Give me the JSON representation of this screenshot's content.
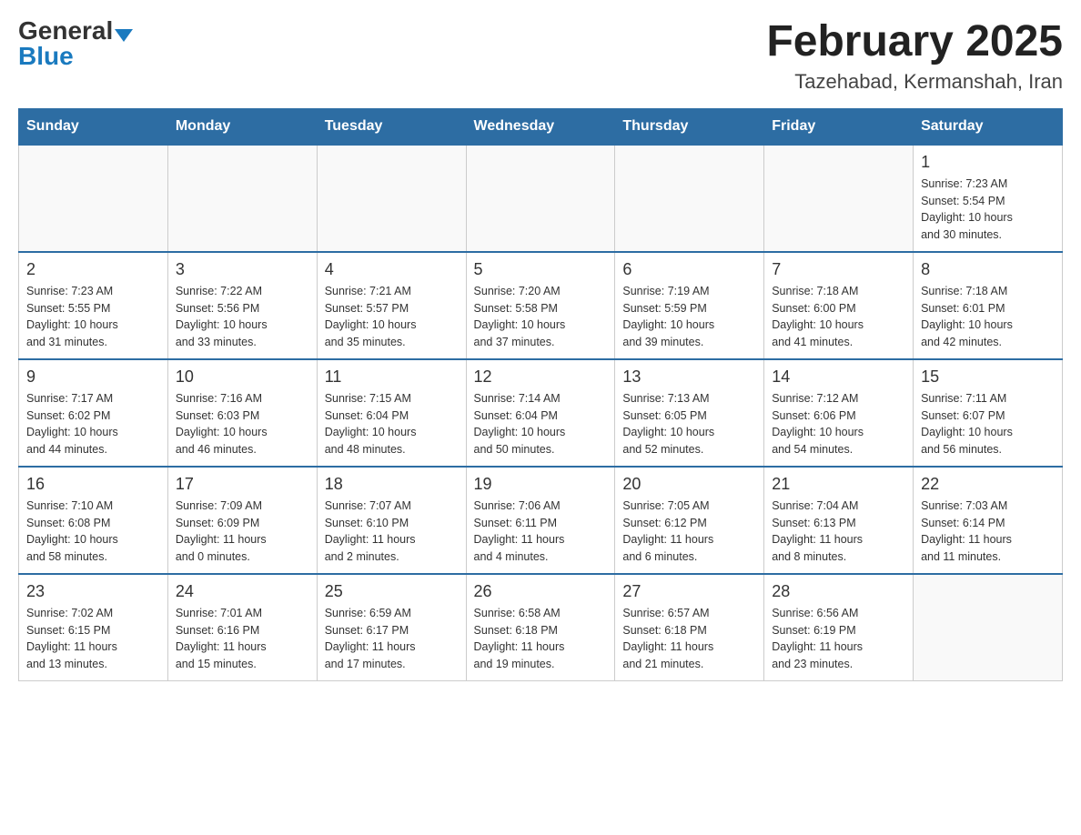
{
  "header": {
    "logo_general": "General",
    "logo_blue": "Blue",
    "month_year": "February 2025",
    "location": "Tazehabad, Kermanshah, Iran"
  },
  "days_of_week": [
    "Sunday",
    "Monday",
    "Tuesday",
    "Wednesday",
    "Thursday",
    "Friday",
    "Saturday"
  ],
  "weeks": [
    {
      "days": [
        {
          "date": "",
          "info": ""
        },
        {
          "date": "",
          "info": ""
        },
        {
          "date": "",
          "info": ""
        },
        {
          "date": "",
          "info": ""
        },
        {
          "date": "",
          "info": ""
        },
        {
          "date": "",
          "info": ""
        },
        {
          "date": "1",
          "info": "Sunrise: 7:23 AM\nSunset: 5:54 PM\nDaylight: 10 hours\nand 30 minutes."
        }
      ]
    },
    {
      "days": [
        {
          "date": "2",
          "info": "Sunrise: 7:23 AM\nSunset: 5:55 PM\nDaylight: 10 hours\nand 31 minutes."
        },
        {
          "date": "3",
          "info": "Sunrise: 7:22 AM\nSunset: 5:56 PM\nDaylight: 10 hours\nand 33 minutes."
        },
        {
          "date": "4",
          "info": "Sunrise: 7:21 AM\nSunset: 5:57 PM\nDaylight: 10 hours\nand 35 minutes."
        },
        {
          "date": "5",
          "info": "Sunrise: 7:20 AM\nSunset: 5:58 PM\nDaylight: 10 hours\nand 37 minutes."
        },
        {
          "date": "6",
          "info": "Sunrise: 7:19 AM\nSunset: 5:59 PM\nDaylight: 10 hours\nand 39 minutes."
        },
        {
          "date": "7",
          "info": "Sunrise: 7:18 AM\nSunset: 6:00 PM\nDaylight: 10 hours\nand 41 minutes."
        },
        {
          "date": "8",
          "info": "Sunrise: 7:18 AM\nSunset: 6:01 PM\nDaylight: 10 hours\nand 42 minutes."
        }
      ]
    },
    {
      "days": [
        {
          "date": "9",
          "info": "Sunrise: 7:17 AM\nSunset: 6:02 PM\nDaylight: 10 hours\nand 44 minutes."
        },
        {
          "date": "10",
          "info": "Sunrise: 7:16 AM\nSunset: 6:03 PM\nDaylight: 10 hours\nand 46 minutes."
        },
        {
          "date": "11",
          "info": "Sunrise: 7:15 AM\nSunset: 6:04 PM\nDaylight: 10 hours\nand 48 minutes."
        },
        {
          "date": "12",
          "info": "Sunrise: 7:14 AM\nSunset: 6:04 PM\nDaylight: 10 hours\nand 50 minutes."
        },
        {
          "date": "13",
          "info": "Sunrise: 7:13 AM\nSunset: 6:05 PM\nDaylight: 10 hours\nand 52 minutes."
        },
        {
          "date": "14",
          "info": "Sunrise: 7:12 AM\nSunset: 6:06 PM\nDaylight: 10 hours\nand 54 minutes."
        },
        {
          "date": "15",
          "info": "Sunrise: 7:11 AM\nSunset: 6:07 PM\nDaylight: 10 hours\nand 56 minutes."
        }
      ]
    },
    {
      "days": [
        {
          "date": "16",
          "info": "Sunrise: 7:10 AM\nSunset: 6:08 PM\nDaylight: 10 hours\nand 58 minutes."
        },
        {
          "date": "17",
          "info": "Sunrise: 7:09 AM\nSunset: 6:09 PM\nDaylight: 11 hours\nand 0 minutes."
        },
        {
          "date": "18",
          "info": "Sunrise: 7:07 AM\nSunset: 6:10 PM\nDaylight: 11 hours\nand 2 minutes."
        },
        {
          "date": "19",
          "info": "Sunrise: 7:06 AM\nSunset: 6:11 PM\nDaylight: 11 hours\nand 4 minutes."
        },
        {
          "date": "20",
          "info": "Sunrise: 7:05 AM\nSunset: 6:12 PM\nDaylight: 11 hours\nand 6 minutes."
        },
        {
          "date": "21",
          "info": "Sunrise: 7:04 AM\nSunset: 6:13 PM\nDaylight: 11 hours\nand 8 minutes."
        },
        {
          "date": "22",
          "info": "Sunrise: 7:03 AM\nSunset: 6:14 PM\nDaylight: 11 hours\nand 11 minutes."
        }
      ]
    },
    {
      "days": [
        {
          "date": "23",
          "info": "Sunrise: 7:02 AM\nSunset: 6:15 PM\nDaylight: 11 hours\nand 13 minutes."
        },
        {
          "date": "24",
          "info": "Sunrise: 7:01 AM\nSunset: 6:16 PM\nDaylight: 11 hours\nand 15 minutes."
        },
        {
          "date": "25",
          "info": "Sunrise: 6:59 AM\nSunset: 6:17 PM\nDaylight: 11 hours\nand 17 minutes."
        },
        {
          "date": "26",
          "info": "Sunrise: 6:58 AM\nSunset: 6:18 PM\nDaylight: 11 hours\nand 19 minutes."
        },
        {
          "date": "27",
          "info": "Sunrise: 6:57 AM\nSunset: 6:18 PM\nDaylight: 11 hours\nand 21 minutes."
        },
        {
          "date": "28",
          "info": "Sunrise: 6:56 AM\nSunset: 6:19 PM\nDaylight: 11 hours\nand 23 minutes."
        },
        {
          "date": "",
          "info": ""
        }
      ]
    }
  ]
}
